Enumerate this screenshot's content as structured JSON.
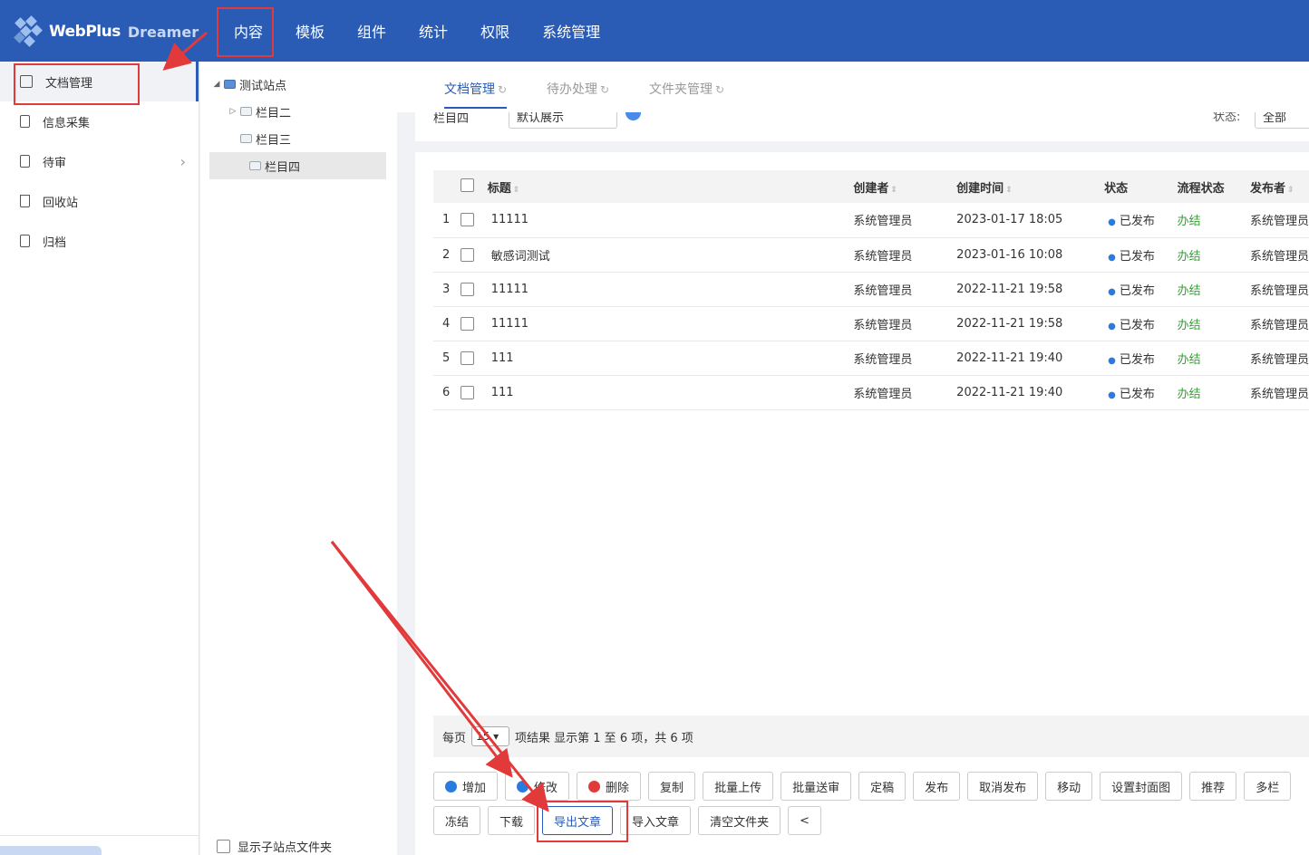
{
  "brand": {
    "name": "WebPlus",
    "sub": "Dreamer"
  },
  "topnav": [
    "内容",
    "模板",
    "组件",
    "统计",
    "权限",
    "系统管理"
  ],
  "sidebar": {
    "items": [
      {
        "label": "文档管理",
        "icon": "folder-icon"
      },
      {
        "label": "信息采集",
        "icon": "document-icon"
      },
      {
        "label": "待审",
        "icon": "review-icon"
      },
      {
        "label": "回收站",
        "icon": "trash-icon"
      },
      {
        "label": "归档",
        "icon": "archive-icon"
      }
    ]
  },
  "tree": {
    "root": "测试站点",
    "children": [
      "栏目二",
      "栏目三",
      "栏目四"
    ],
    "footer_label": "显示子站点文件夹"
  },
  "tabs": [
    "文档管理",
    "待办处理",
    "文件夹管理"
  ],
  "filter": {
    "column": "栏目四",
    "view": "默认展示",
    "status_label": "状态:",
    "status_value": "全部"
  },
  "table": {
    "headers": [
      "标题",
      "创建者",
      "创建时间",
      "状态",
      "流程状态",
      "发布者"
    ],
    "rows": [
      {
        "n": "1",
        "title": "11111",
        "creator": "系统管理员",
        "time": "2023-01-17 18:05",
        "status": "已发布",
        "flow": "办结",
        "publisher": "系统管理员"
      },
      {
        "n": "2",
        "title": "敏感词测试",
        "creator": "系统管理员",
        "time": "2023-01-16 10:08",
        "status": "已发布",
        "flow": "办结",
        "publisher": "系统管理员"
      },
      {
        "n": "3",
        "title": "11111",
        "creator": "系统管理员",
        "time": "2022-11-21 19:58",
        "status": "已发布",
        "flow": "办结",
        "publisher": "系统管理员"
      },
      {
        "n": "4",
        "title": "11111",
        "creator": "系统管理员",
        "time": "2022-11-21 19:58",
        "status": "已发布",
        "flow": "办结",
        "publisher": "系统管理员"
      },
      {
        "n": "5",
        "title": "111",
        "creator": "系统管理员",
        "time": "2022-11-21 19:40",
        "status": "已发布",
        "flow": "办结",
        "publisher": "系统管理员"
      },
      {
        "n": "6",
        "title": "111",
        "creator": "系统管理员",
        "time": "2022-11-21 19:40",
        "status": "已发布",
        "flow": "办结",
        "publisher": "系统管理员"
      }
    ]
  },
  "pager": {
    "per_page_label": "每页",
    "per_page_value": "15",
    "summary": "项结果 显示第 1 至 6 项，共 6 项"
  },
  "buttons_row1": [
    "增加",
    "修改",
    "删除",
    "复制",
    "批量上传",
    "批量送审",
    "定稿",
    "发布",
    "取消发布",
    "移动",
    "设置封面图",
    "推荐",
    "多栏"
  ],
  "buttons_row2": [
    "冻结",
    "下载",
    "导出文章",
    "导入文章",
    "清空文件夹",
    "<"
  ],
  "colors": {
    "brand_blue": "#2a5bb5",
    "highlight_red": "#e2393b",
    "flow_green": "#3a9c3a"
  }
}
